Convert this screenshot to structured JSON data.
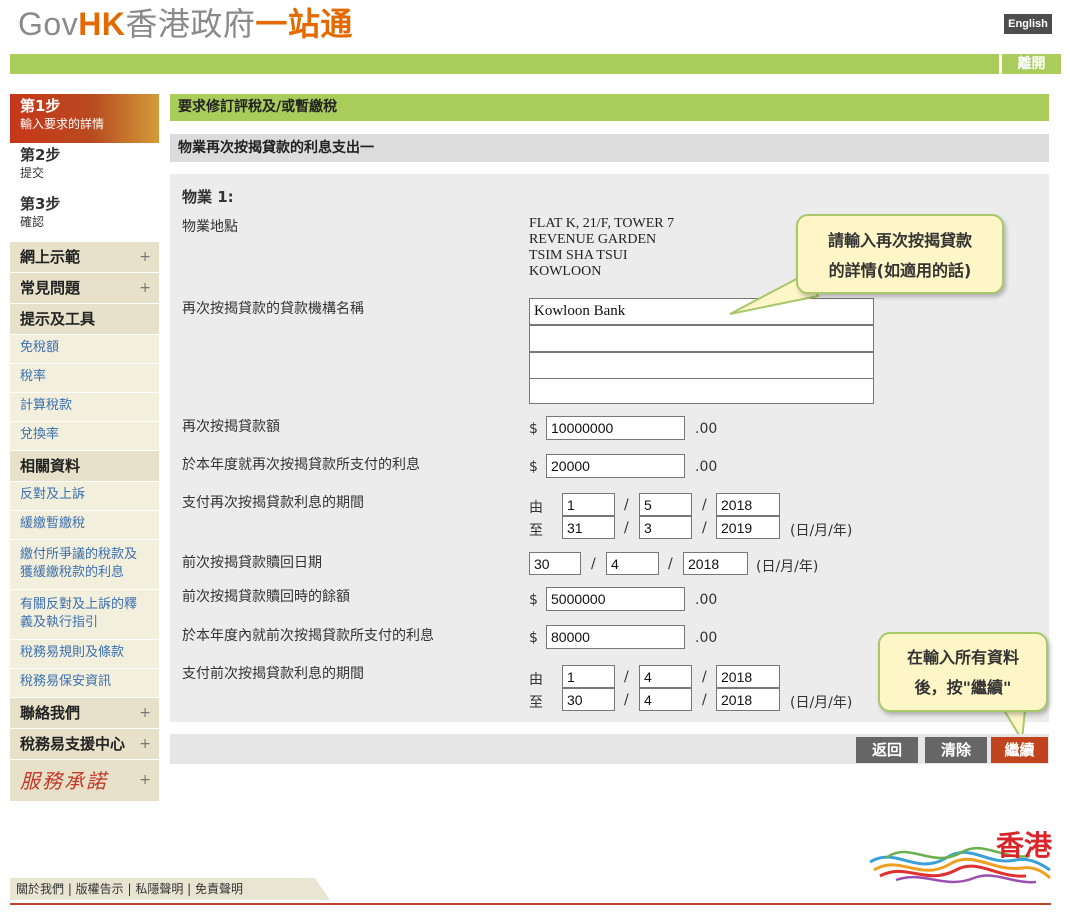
{
  "header": {
    "logo_gov": "Gov",
    "logo_hk": "HK",
    "logo_cn": "香港政府",
    "logo_onestop": "一站通",
    "lang_button": "English",
    "exit_button": "離開"
  },
  "sidebar": {
    "steps": [
      {
        "title": "第1步",
        "subtitle": "輸入要求的詳情"
      },
      {
        "title": "第2步",
        "subtitle": "提交"
      },
      {
        "title": "第3步",
        "subtitle": "確認"
      }
    ],
    "menu": {
      "demo": "網上示範",
      "faq": "常見問題",
      "tips": "提示及工具",
      "allowances": "免稅額",
      "tax_rates": "稅率",
      "tax_calc": "計算稅款",
      "exchange": "兌換率",
      "related": "相關資料",
      "objection": "反對及上訴",
      "holdover": "緩繳暫繳稅",
      "interest_on_tax": "繳付所爭議的稅款及獲緩繳稅款的利息",
      "guide": "有關反對及上訴的釋義及執行指引",
      "terms": "稅務易規則及條款",
      "security": "稅務易保安資訊",
      "contact": "聯絡我們",
      "support": "稅務易支援中心",
      "pledge": "服務承諾",
      "plus": "+"
    }
  },
  "main": {
    "header1": "要求修訂評稅及/或暫繳稅",
    "header2": "物業再次按揭貸款的利息支出一",
    "property_title": "物業 1:",
    "address_label": "物業地點",
    "address_value": "FLAT K, 21/F, TOWER 7\nREVENUE GARDEN\nTSIM SHA TSUI\nKOWLOON",
    "lender_label": "再次按揭貸款的貸款機構名稱",
    "lender_lines": [
      "Kowloon Bank",
      "",
      "",
      ""
    ],
    "amount_label": "再次按揭貸款額",
    "amount_value": "10000000",
    "interest_label": "於本年度就再次按揭貸款所支付的利息",
    "interest_value": "20000",
    "period_label": "支付再次按揭貸款利息的期間",
    "period_from": {
      "day": "1",
      "month": "5",
      "year": "2018"
    },
    "period_to": {
      "day": "31",
      "month": "3",
      "year": "2019"
    },
    "redeem_date_label": "前次按揭貸款贖回日期",
    "redeem_date": {
      "day": "30",
      "month": "4",
      "year": "2018"
    },
    "balance_label": "前次按揭貸款贖回時的餘額",
    "balance_value": "5000000",
    "prev_interest_label": "於本年度內就前次按揭貸款所支付的利息",
    "prev_interest_value": "80000",
    "prev_period_label": "支付前次按揭貸款利息的期間",
    "prev_period_from": {
      "day": "1",
      "month": "4",
      "year": "2018"
    },
    "prev_period_to": {
      "day": "30",
      "month": "4",
      "year": "2018"
    },
    "dollar": "$",
    "cents": ".00",
    "from_label": "由",
    "to_label": "至",
    "slash": "/",
    "date_format": "(日/月/年)"
  },
  "buttons": {
    "back": "返回",
    "clear": "清除",
    "next": "繼續"
  },
  "callouts": {
    "lender_tip_1": "請輸入再次按揭貸款",
    "lender_tip_2": "的詳情(如適用的話)",
    "continue_tip_1": "在輸入所有資料",
    "continue_tip_2": "後，按\"繼續\""
  },
  "footer": {
    "links": "關於我們 | 版權告示 | 私隱聲明 | 免責聲明",
    "brand": "香港"
  },
  "colors": {
    "green": "#a9cc5a",
    "orange": "#e46a00",
    "red": "#c0441d"
  }
}
